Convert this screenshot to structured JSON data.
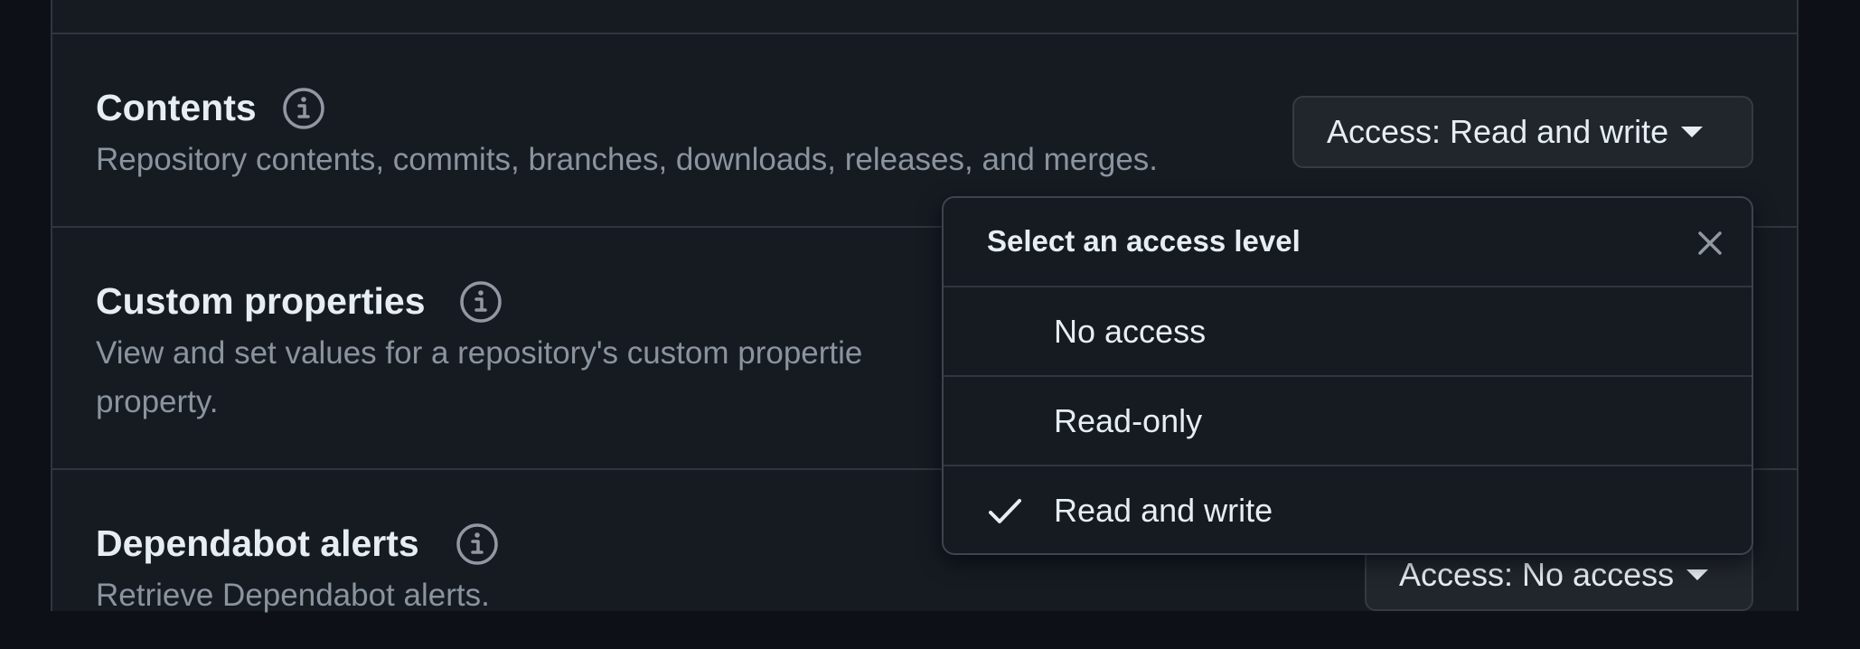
{
  "permissions": [
    {
      "title": "Contents",
      "description": "Repository contents, commits, branches, downloads, releases, and merges.",
      "access_label": "Access: Read and write"
    },
    {
      "title": "Custom properties",
      "description_line1": "View and set values for a repository's custom propertie",
      "description_line2": "property."
    },
    {
      "title": "Dependabot alerts",
      "description": "Retrieve Dependabot alerts.",
      "access_label": "Access: No access"
    }
  ],
  "dropdown": {
    "title": "Select an access level",
    "options": [
      {
        "label": "No access",
        "selected": false
      },
      {
        "label": "Read-only",
        "selected": false
      },
      {
        "label": "Read and write",
        "selected": true
      }
    ]
  },
  "icons": {
    "info": "info-icon",
    "close": "close-icon",
    "check": "check-icon",
    "caret": "caret-down-icon"
  },
  "colors": {
    "background": "#0d1117",
    "panel": "#161b22",
    "border": "#30363d",
    "text": "#e6edf3",
    "muted_text": "#8b949e",
    "button": "#21262d"
  }
}
